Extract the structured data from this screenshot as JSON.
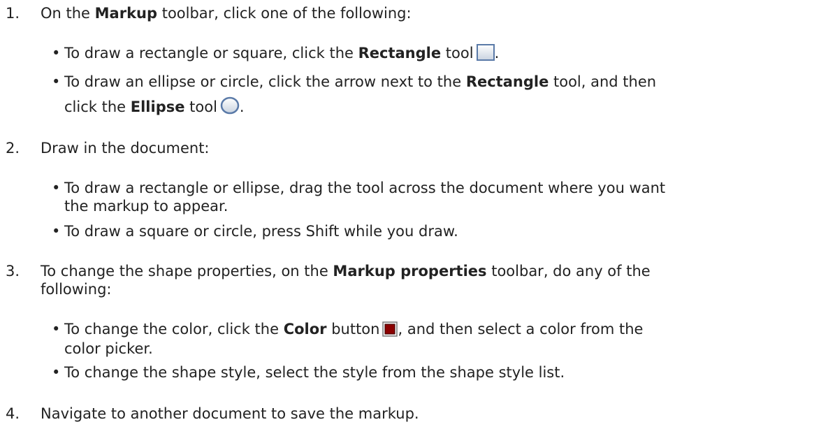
{
  "steps": [
    {
      "num": "1.",
      "pre": "On the ",
      "bold": "Markup",
      "post": " toolbar, click one of the following:",
      "bullets": [
        {
          "pre": "To draw a rectangle or square, click the ",
          "bold": "Rectangle",
          "post": " tool",
          "icon": "rectangle-tool-icon",
          "after": "."
        },
        {
          "line1_pre": "To draw an ellipse or circle, click the arrow next to the ",
          "line1_bold": "Rectangle",
          "line1_post": " tool, and then",
          "line2_pre": "click the ",
          "line2_bold": "Ellipse",
          "line2_post": " tool",
          "icon": "ellipse-tool-icon",
          "after": "."
        }
      ]
    },
    {
      "num": "2.",
      "text": "Draw in the document:",
      "bullets": [
        {
          "line1": "To draw a rectangle or ellipse, drag the tool across the document where you want",
          "line2": "the markup to appear."
        },
        {
          "line1": "To draw a square or circle, press Shift while you draw."
        }
      ]
    },
    {
      "num": "3.",
      "pre": "To change the shape properties, on the ",
      "bold": "Markup properties",
      "post": " toolbar, do any of the",
      "line2": "following:",
      "bullets": [
        {
          "pre": "To change the color, click the ",
          "bold": "Color",
          "post": " button",
          "icon": "color-button-icon",
          "after": ", and then select a color from the",
          "line2": "color picker."
        },
        {
          "line1": "To change the shape style, select the style from the shape style list."
        }
      ]
    },
    {
      "num": "4.",
      "text": "Navigate to another document to save the markup."
    }
  ],
  "bullet_glyph": "•",
  "colors": {
    "text": "#222222",
    "color_swatch": "#8b0000"
  }
}
